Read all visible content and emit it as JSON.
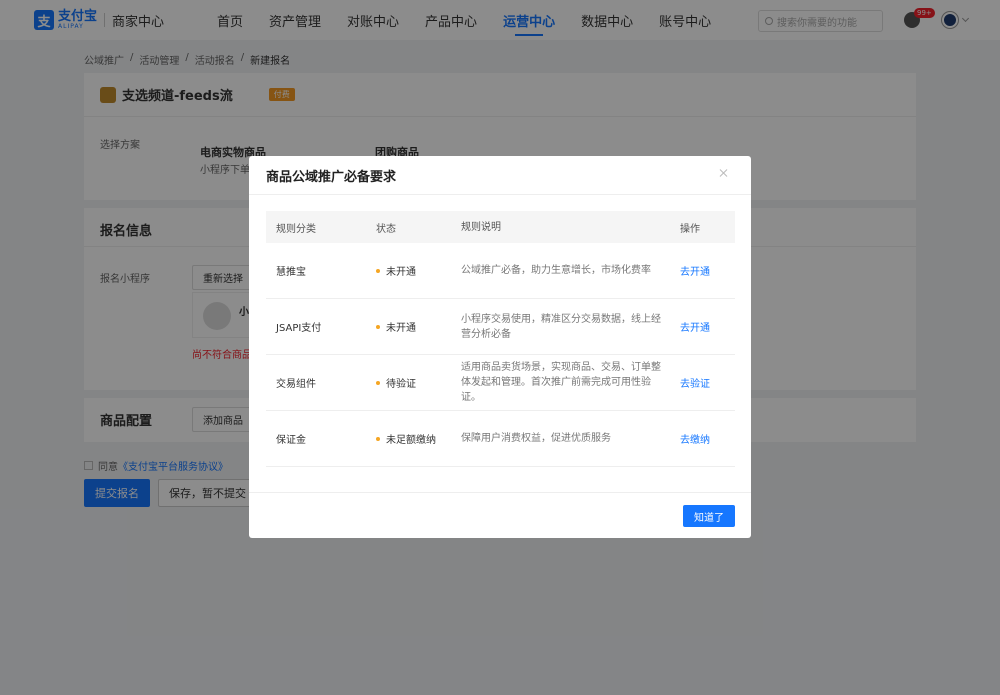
{
  "nav": {
    "logo_cn": "支付宝",
    "logo_en": "ALIPAY",
    "logo_glyph": "支",
    "sub_title": "商家中心",
    "items": [
      {
        "label": "首页"
      },
      {
        "label": "资产管理"
      },
      {
        "label": "对账中心"
      },
      {
        "label": "产品中心"
      },
      {
        "label": "运营中心",
        "active": true
      },
      {
        "label": "数据中心"
      },
      {
        "label": "账号中心"
      }
    ],
    "search_placeholder": "搜索你需要的功能",
    "badge": "99+"
  },
  "breadcrumb": [
    "公域推广",
    "/",
    "活动管理",
    "/",
    "活动报名",
    "/",
    "新建报名"
  ],
  "activity": {
    "title": "支选频道-feeds流",
    "tag": "付费",
    "plan_label": "选择方案",
    "plan_opt1": "电商实物商品",
    "plan_opt1_sub": "小程序下单",
    "plan_opt2": "团购商品"
  },
  "signup": {
    "title": "报名信息",
    "mini_label": "报名小程序",
    "reselect": "重新选择",
    "mini_name": "小",
    "error": "尚不符合商品"
  },
  "goods": {
    "title": "商品配置",
    "add": "添加商品"
  },
  "agree": {
    "prefix": "同意",
    "link": "《支付宝平台服务协议》"
  },
  "buttons": {
    "submit": "提交报名",
    "save": "保存，暂不提交"
  },
  "modal": {
    "title": "商品公域推广必备要求",
    "headers": [
      "规则分类",
      "状态",
      "规则说明",
      "操作"
    ],
    "rows": [
      {
        "category": "慧推宝",
        "status": "未开通",
        "desc": "公域推广必备，助力生意增长，市场化费率",
        "action": "去开通"
      },
      {
        "category": "JSAPI支付",
        "status": "未开通",
        "desc": "小程序交易使用，精准区分交易数据，线上经营分析必备",
        "action": "去开通"
      },
      {
        "category": "交易组件",
        "status": "待验证",
        "desc": "适用商品卖货场景，实现商品、交易、订单整体发起和管理。首次推广前需完成可用性验证。",
        "action": "去验证"
      },
      {
        "category": "保证金",
        "status": "未足额缴纳",
        "desc": "保障用户消费权益，促进优质服务",
        "action": "去缴纳"
      }
    ],
    "ok": "知道了"
  },
  "colors": {
    "primary": "#1677ff",
    "warning_dot": "#f5a623",
    "error": "#f5222d"
  }
}
